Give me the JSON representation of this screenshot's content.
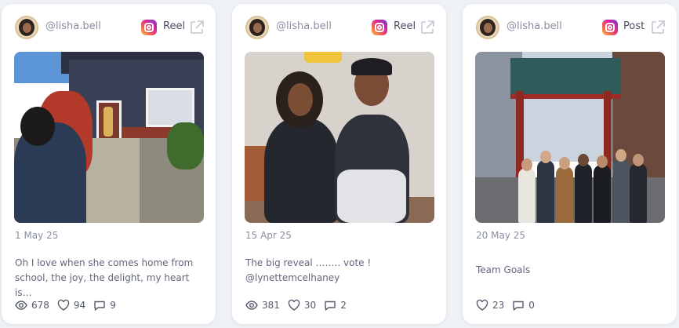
{
  "cards": [
    {
      "handle": "@lisha.bell",
      "type": "Reel",
      "date": "1 May 25",
      "caption": "Oh I love when she comes home from school, the joy, the delight, my heart is…",
      "views": "678",
      "likes": "94",
      "comments": "9",
      "platform_icon": "instagram-icon",
      "photo_alt": ""
    },
    {
      "handle": "@lisha.bell",
      "type": "Reel",
      "date": "15 Apr 25",
      "caption": "The big reveal …….. vote ! @lynettemcelhaney",
      "views": "381",
      "likes": "30",
      "comments": "2",
      "platform_icon": "instagram-icon"
    },
    {
      "handle": "@lisha.bell",
      "type": "Post",
      "date": "20 May 25",
      "caption": "Team Goals",
      "likes": "23",
      "comments": "0",
      "platform_icon": "instagram-icon"
    }
  ],
  "colors": {
    "background": "#eef1f5",
    "card": "#ffffff",
    "muted_text": "#8a8fa0"
  }
}
